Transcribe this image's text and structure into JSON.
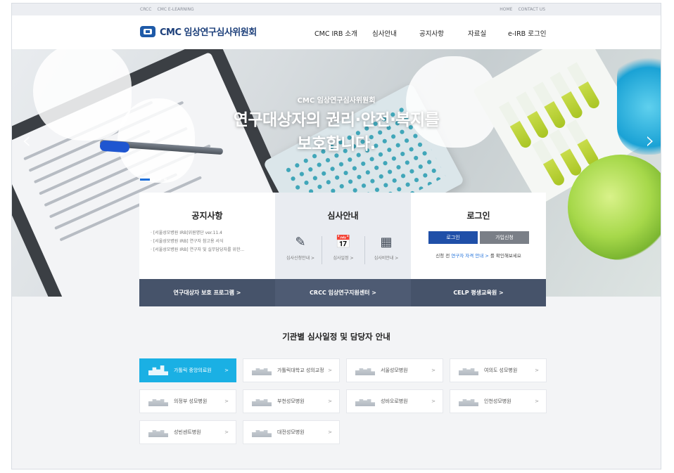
{
  "utility": {
    "left": [
      "CRCC",
      "CMC E-LEARNING"
    ],
    "right": [
      "HOME",
      "CONTACT US"
    ]
  },
  "header": {
    "logo_text": "CMC 임상연구심사위원회",
    "menu": [
      "CMC IRB 소개",
      "심사안내",
      "공지사항",
      "자료실",
      "e-IRB 로그인"
    ]
  },
  "hero": {
    "subtitle": "CMC 임상연구심사위원회",
    "title_line1": "연구대상자의 권리·안전·복지를",
    "title_line2": "보호합니다.",
    "prev_icon": "chevron-left-icon",
    "next_icon": "chevron-right-icon"
  },
  "notice": {
    "title": "공지사항",
    "items": [
      "[서울성모병원 IRB]위원명단 ver.11.4",
      "[서울성모병원 IRB] 연구자 참고용 서식",
      "[서울성모병원 IRB] 연구자 및 실무담당자를 위한..."
    ]
  },
  "review": {
    "title": "심사안내",
    "links": [
      {
        "icon": "edit-form-icon",
        "label": "심사신청안내 >"
      },
      {
        "icon": "calendar-icon",
        "label": "심사일정 >"
      },
      {
        "icon": "calculator-icon",
        "label": "심사비안내 >"
      }
    ]
  },
  "login": {
    "title": "로그인",
    "login_button": "로그인",
    "join_button": "가입신청",
    "hint_prefix": "신청 전",
    "hint_link": "연구자 자격 안내 >",
    "hint_suffix": "를 확인해보세요"
  },
  "bars": [
    "연구대상자 보호 프로그램 >",
    "CRCC 임상연구지원센터 >",
    "CELP 평생교육원 >"
  ],
  "hospitals": {
    "title": "기관별 심사일정 및 담당자 안내",
    "items": [
      "가톨릭 중앙의료원",
      "가톨릭대학교 성의교정",
      "서울성모병원",
      "여의도 성모병원",
      "의정부 성모병원",
      "부천성모병원",
      "성바오로병원",
      "인천성모병원",
      "성빈센트병원",
      "대전성모병원"
    ],
    "chevron": ">"
  },
  "colors": {
    "brand_navy": "#1c3f7a",
    "login_blue": "#1f4fa8",
    "join_gray": "#7a7f87",
    "bar_slate": "#46536a",
    "active_cyan": "#1ab0e4"
  }
}
